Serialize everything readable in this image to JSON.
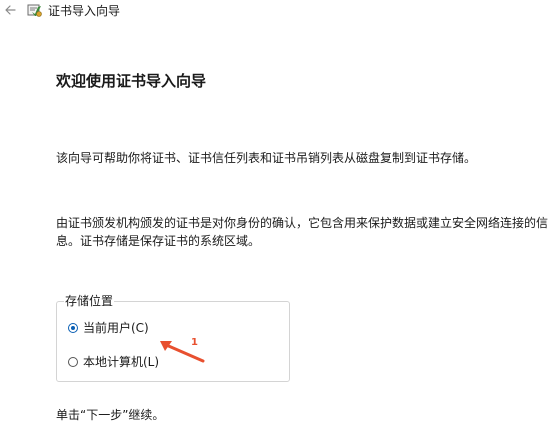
{
  "window": {
    "title": "证书导入向导"
  },
  "icons": {
    "back": "back-arrow-icon",
    "app": "certificate-icon",
    "annotation": "annotation-arrow-icon"
  },
  "main": {
    "heading": "欢迎使用证书导入向导",
    "paragraph1": "该向导可帮助你将证书、证书信任列表和证书吊销列表从磁盘复制到证书存储。",
    "paragraph2": "由证书颁发机构颁发的证书是对你身份的确认，它包含用来保护数据或建立安全网络连接的信息。证书存储是保存证书的系统区域。"
  },
  "storage_location": {
    "legend": "存储位置",
    "options": [
      {
        "label": "当前用户(C)",
        "selected": true
      },
      {
        "label": "本地计算机(L)",
        "selected": false
      }
    ]
  },
  "annotation": {
    "number": "1",
    "color": "#e8502f"
  },
  "footer": {
    "text": "单击“下一步”继续。"
  },
  "colors": {
    "accent": "#0a5fb4",
    "annotation": "#e8502f"
  }
}
